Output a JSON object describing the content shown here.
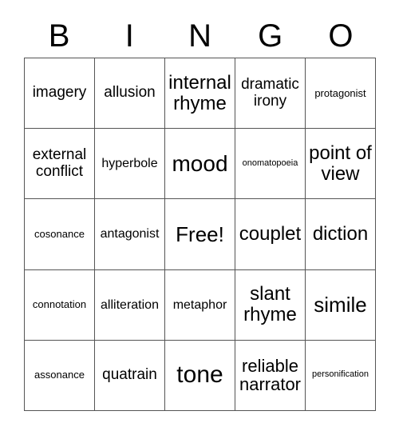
{
  "card": {
    "header_letters": [
      "B",
      "I",
      "N",
      "G",
      "O"
    ],
    "rows": [
      [
        {
          "label": "imagery",
          "size": "fs-l"
        },
        {
          "label": "allusion",
          "size": "fs-l"
        },
        {
          "label": "internal\nrhyme",
          "size": "fs-xxl"
        },
        {
          "label": "dramatic\nirony",
          "size": "fs-l"
        },
        {
          "label": "protagonist",
          "size": "fs-s"
        }
      ],
      [
        {
          "label": "external\nconflict",
          "size": "fs-l"
        },
        {
          "label": "hyperbole",
          "size": "fs-m"
        },
        {
          "label": "mood",
          "size": "fs-4xl"
        },
        {
          "label": "onomatopoeia",
          "size": "fs-xs"
        },
        {
          "label": "point of\nview",
          "size": "fs-xxl"
        }
      ],
      [
        {
          "label": "cosonance",
          "size": "fs-s"
        },
        {
          "label": "antagonist",
          "size": "fs-m"
        },
        {
          "label": "Free!",
          "size": "fs-3xl"
        },
        {
          "label": "couplet",
          "size": "fs-xxl"
        },
        {
          "label": "diction",
          "size": "fs-xxl"
        }
      ],
      [
        {
          "label": "connotation",
          "size": "fs-s"
        },
        {
          "label": "alliteration",
          "size": "fs-m"
        },
        {
          "label": "metaphor",
          "size": "fs-m"
        },
        {
          "label": "slant\nrhyme",
          "size": "fs-xxl"
        },
        {
          "label": "simile",
          "size": "fs-3xl"
        }
      ],
      [
        {
          "label": "assonance",
          "size": "fs-s"
        },
        {
          "label": "quatrain",
          "size": "fs-l"
        },
        {
          "label": "tone",
          "size": "fs-5xl"
        },
        {
          "label": "reliable\nnarrator",
          "size": "fs-xl"
        },
        {
          "label": "personification",
          "size": "fs-xs"
        }
      ]
    ]
  }
}
